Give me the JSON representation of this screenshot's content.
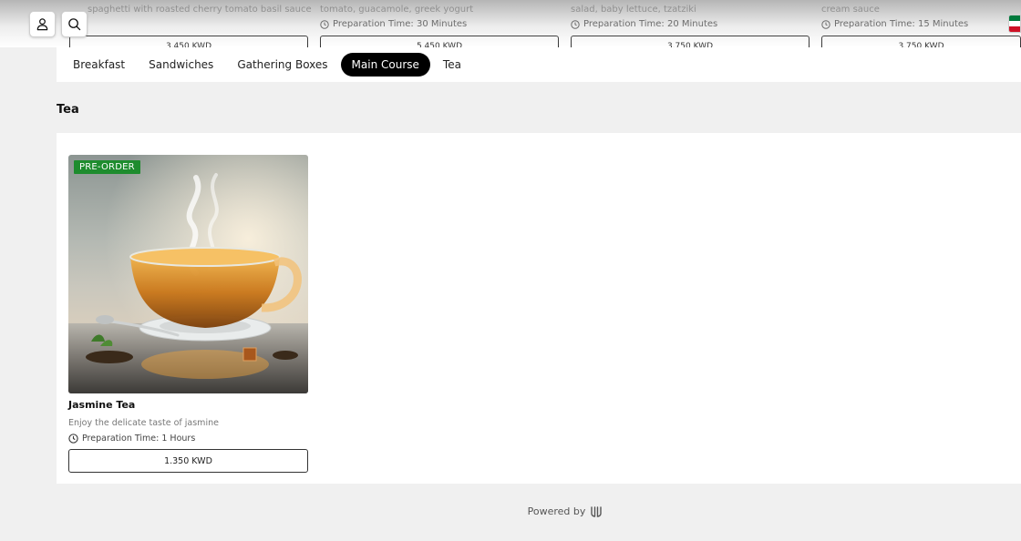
{
  "prev_section": {
    "items": [
      {
        "description": "spaghetti with roasted cherry tomato basil sauce",
        "prep": "",
        "price": "3.450 KWD"
      },
      {
        "description": "tomato, guacamole, greek yogurt",
        "prep": "Preparation Time: 30 Minutes",
        "price": "5.450 KWD"
      },
      {
        "description": "salad, baby lettuce, tzatziki",
        "prep": "Preparation Time: 20 Minutes",
        "price": "3.750 KWD"
      },
      {
        "description": "cream sauce",
        "prep": "Preparation Time: 15 Minutes",
        "price": "3.750 KWD"
      }
    ]
  },
  "header": {
    "account_icon": "user-icon",
    "search_icon": "search-icon"
  },
  "tabs": [
    {
      "label": "Breakfast"
    },
    {
      "label": "Sandwiches"
    },
    {
      "label": "Gathering Boxes"
    },
    {
      "label": "Main Course",
      "active": true
    },
    {
      "label": "Tea"
    }
  ],
  "section": {
    "title": "Tea",
    "items": [
      {
        "badge": "PRE-ORDER",
        "name": "Jasmine Tea",
        "description": "Enjoy the delicate taste of jasmine",
        "prep": "Preparation Time: 1 Hours",
        "price": "1.350 KWD"
      }
    ]
  },
  "footer": {
    "powered_by": "Powered by"
  },
  "colors": {
    "accent": "#000000",
    "badge": "#1e8c2e",
    "background": "#f0f0f0"
  }
}
